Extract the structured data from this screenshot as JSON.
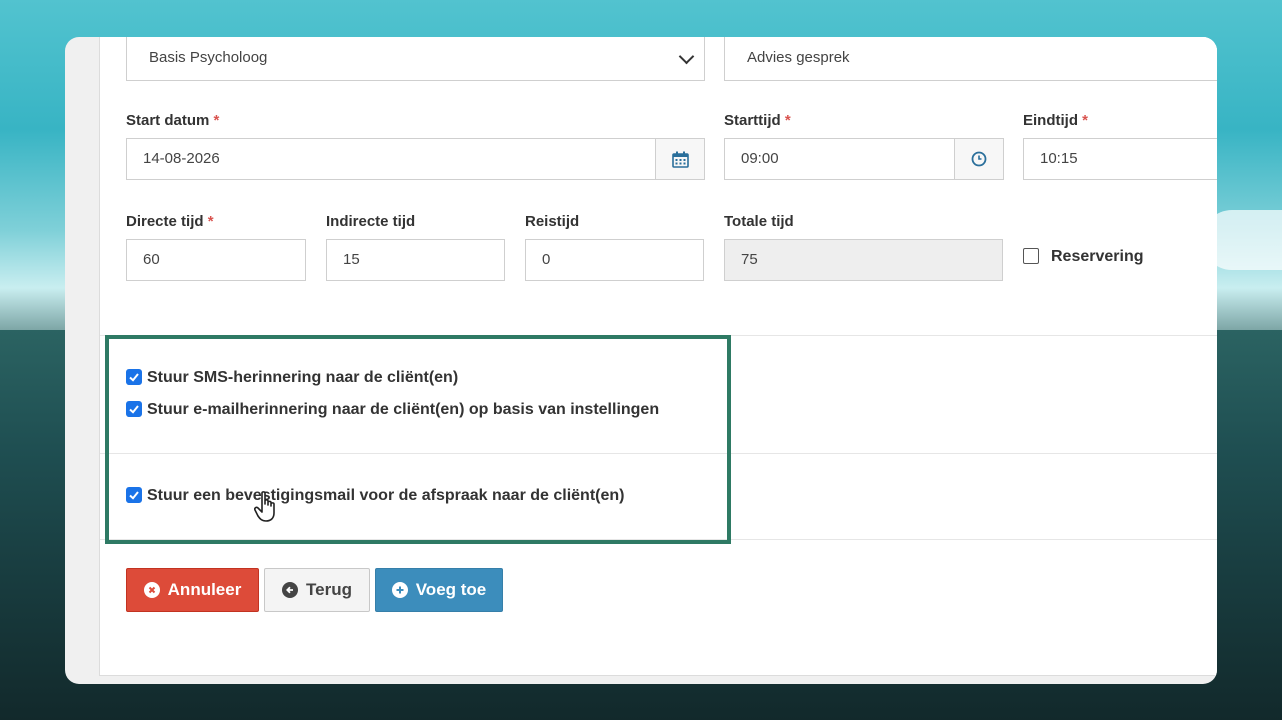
{
  "form": {
    "select_psychologist": {
      "value": "Basis Psycholoog"
    },
    "select_type": {
      "value": "Advies gesprek"
    },
    "start_date": {
      "label": "Start datum",
      "required": "*",
      "value": "14-08-2026"
    },
    "start_time": {
      "label": "Starttijd",
      "required": "*",
      "value": "09:00"
    },
    "end_time": {
      "label": "Eindtijd",
      "required": "*",
      "value": "10:15"
    },
    "direct_time": {
      "label": "Directe tijd",
      "required": "*",
      "value": "60"
    },
    "indirect_time": {
      "label": "Indirecte tijd",
      "value": "15"
    },
    "travel_time": {
      "label": "Reistijd",
      "value": "0"
    },
    "total_time": {
      "label": "Totale tijd",
      "value": "75"
    },
    "reservation": {
      "label": "Reservering",
      "checked": false
    }
  },
  "reminders": {
    "sms": {
      "label": "Stuur SMS-herinnering naar de cliënt(en)",
      "checked": true
    },
    "email": {
      "label": "Stuur e-mailherinnering naar de cliënt(en) op basis van instellingen",
      "checked": true
    },
    "confirmation": {
      "label": "Stuur een bevestigingsmail voor de afspraak naar de cliënt(en)",
      "checked": true
    }
  },
  "buttons": {
    "cancel": "Annuleer",
    "back": "Terug",
    "add": "Voeg toe"
  },
  "colors": {
    "checkbox": "#1a73e8",
    "highlight": "#2e7a64",
    "danger": "#dd4b39",
    "primary": "#3c8dbc",
    "required": "#d9534f"
  }
}
